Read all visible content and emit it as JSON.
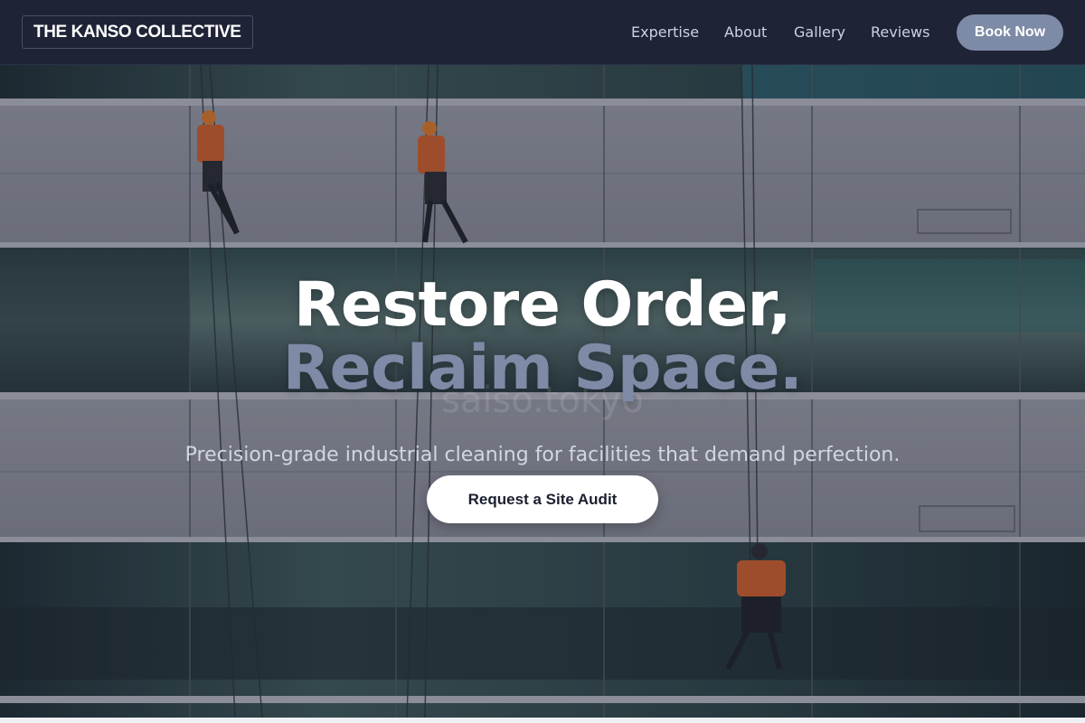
{
  "brand": {
    "name": "THE KANSO COLLECTIVE"
  },
  "nav": {
    "links": [
      "Expertise",
      "About",
      "Gallery",
      "Reviews"
    ],
    "cta_label": "Book Now"
  },
  "hero": {
    "headline_line1": "Restore Order,",
    "headline_line2": "Reclaim Space.",
    "watermark": "saiso.tokyo",
    "subtitle": "Precision-grade industrial cleaning for facilities that demand perfection.",
    "cta_label": "Request a Site Audit",
    "image_icon": "building-facade-window-cleaners-photo"
  },
  "colors": {
    "nav_bg": "#1e2336",
    "accent": "#7e8ba6",
    "headline": "#ffffff",
    "headline_accent": "#7e8aa6",
    "cta_bg": "#ffffff",
    "cta_text": "#1a1f30"
  }
}
